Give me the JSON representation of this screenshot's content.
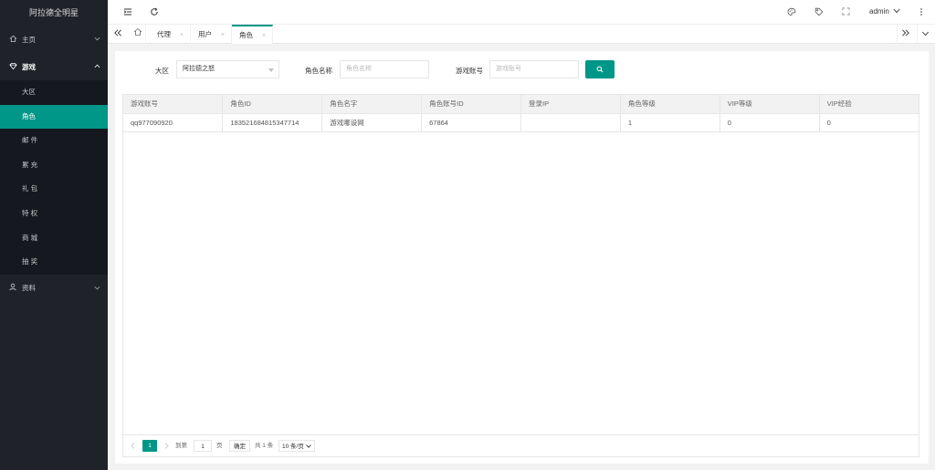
{
  "app": {
    "title": "阿拉德全明星"
  },
  "sidebar": {
    "groups": [
      {
        "label": "主页",
        "icon": "home-icon"
      },
      {
        "label": "游戏",
        "icon": "diamond-icon"
      },
      {
        "label": "资料",
        "icon": "user-icon"
      }
    ],
    "game_items": [
      {
        "label": "大区"
      },
      {
        "label": "角色"
      },
      {
        "label": "邮 件"
      },
      {
        "label": "累 充"
      },
      {
        "label": "礼 包"
      },
      {
        "label": "特 权"
      },
      {
        "label": "商 城"
      },
      {
        "label": "抽 奖"
      }
    ],
    "active_item": "角色",
    "active_color": "#009688"
  },
  "header": {
    "user": "admin",
    "icons": [
      "menu-fold-icon",
      "refresh-icon",
      "theme-icon",
      "tag-icon",
      "fullscreen-icon",
      "more-icon"
    ]
  },
  "tabs": {
    "items": [
      {
        "label": "代理",
        "closable": true
      },
      {
        "label": "用户",
        "closable": true
      },
      {
        "label": "角色",
        "closable": true
      }
    ],
    "active": "角色",
    "close_glyph": "×"
  },
  "filters": {
    "region_label": "大区",
    "region_value": "阿拉德之怒",
    "role_name_label": "角色名称",
    "role_name_placeholder": "角色名称",
    "account_label": "游戏账号",
    "account_placeholder": "游戏账号"
  },
  "table": {
    "columns": [
      "游戏账号",
      "角色ID",
      "角色名字",
      "角色账号ID",
      "登录IP",
      "角色等级",
      "VIP等级",
      "VIP经验"
    ],
    "rows": [
      [
        "qq977090920",
        "183521684815347714",
        "游戏哪设网",
        "67864",
        "",
        "1",
        "0",
        "0"
      ]
    ]
  },
  "pagination": {
    "current_page": "1",
    "goto_label": "到第",
    "goto_value": "1",
    "page_unit": "页",
    "confirm_label": "确定",
    "total_text": "共 1 条",
    "page_size": "10 条/页"
  },
  "colors": {
    "accent": "#009688",
    "sidebar_bg": "#20222a",
    "sidebar_sub_bg": "#161820"
  }
}
